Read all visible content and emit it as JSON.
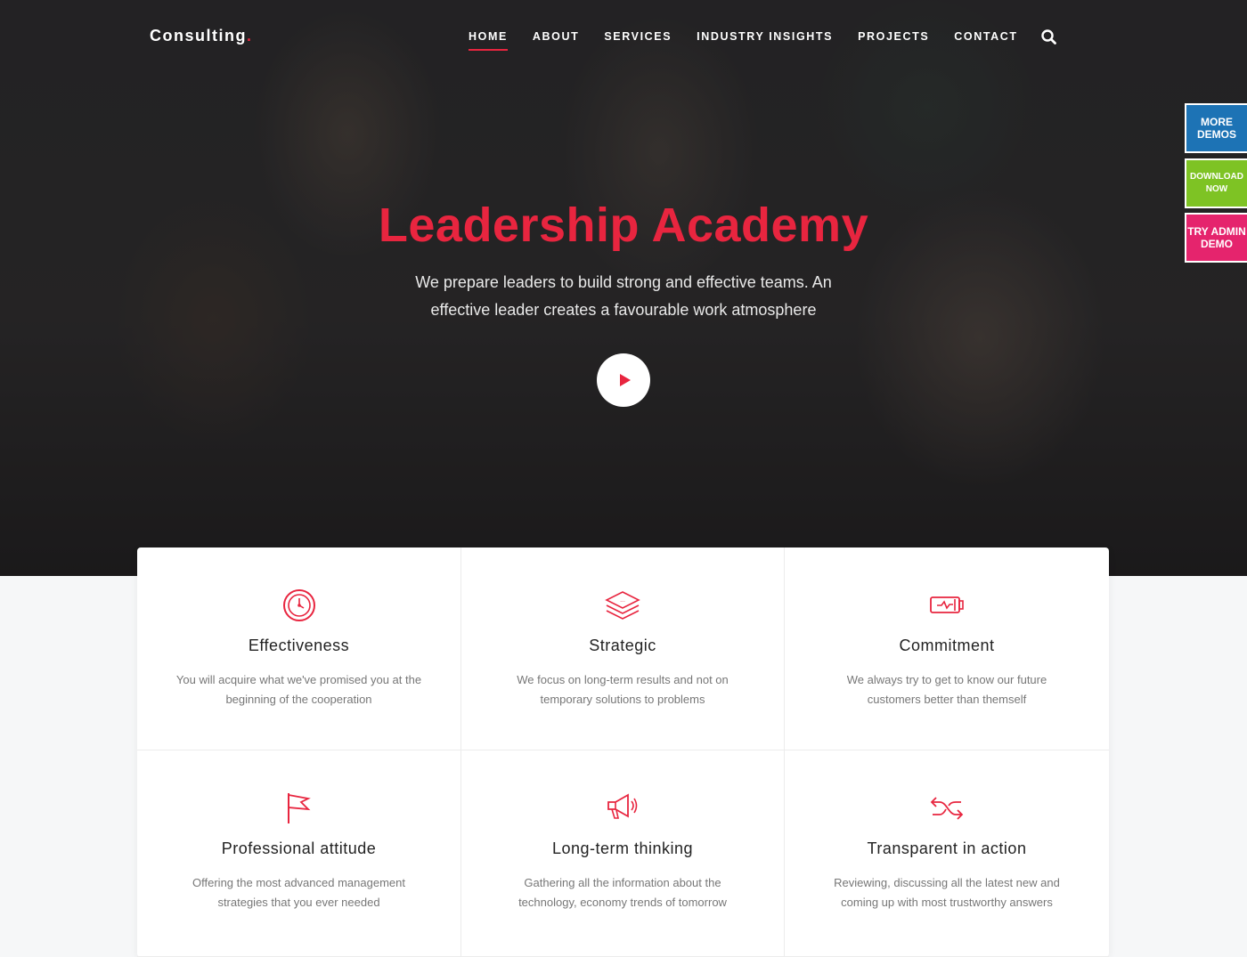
{
  "brand": {
    "name": "Consulting",
    "dot": ".",
    "accent": "#e8253f"
  },
  "nav": {
    "items": [
      {
        "label": "HOME",
        "active": true
      },
      {
        "label": "ABOUT"
      },
      {
        "label": "SERVICES"
      },
      {
        "label": "INDUSTRY INSIGHTS"
      },
      {
        "label": "PROJECTS"
      },
      {
        "label": "CONTACT"
      }
    ],
    "search_icon": "search-icon"
  },
  "hero": {
    "title": "Leadership Academy",
    "subtitle": "We prepare leaders to build strong and effective teams. An effective leader creates a favourable work atmosphere",
    "play_icon": "play-icon"
  },
  "side_buttons": [
    {
      "label": "MORE DEMOS",
      "color": "#1d73b5"
    },
    {
      "label": "DOWNLOAD NOW",
      "color": "#7ec324"
    },
    {
      "label": "TRY ADMIN DEMO",
      "color": "#e5246d"
    }
  ],
  "features": [
    {
      "icon": "stopwatch-icon",
      "title": "Effectiveness",
      "text": "You will acquire what we've promised you at the beginning of the cooperation"
    },
    {
      "icon": "layers-icon",
      "title": "Strategic",
      "text": "We focus on long-term results and not on temporary solutions to problems"
    },
    {
      "icon": "battery-icon",
      "title": "Commitment",
      "text": "We always try to get to know our future customers better than themself"
    },
    {
      "icon": "flag-icon",
      "title": "Professional attitude",
      "text": "Offering the most advanced management strategies  that you ever needed"
    },
    {
      "icon": "megaphone-icon",
      "title": "Long-term thinking",
      "text": "Gathering all the information about the technology, economy trends of tomorrow"
    },
    {
      "icon": "shuffle-icon",
      "title": "Transparent in action",
      "text": "Reviewing, discussing all the latest new and coming up with most trustworthy answers"
    }
  ]
}
